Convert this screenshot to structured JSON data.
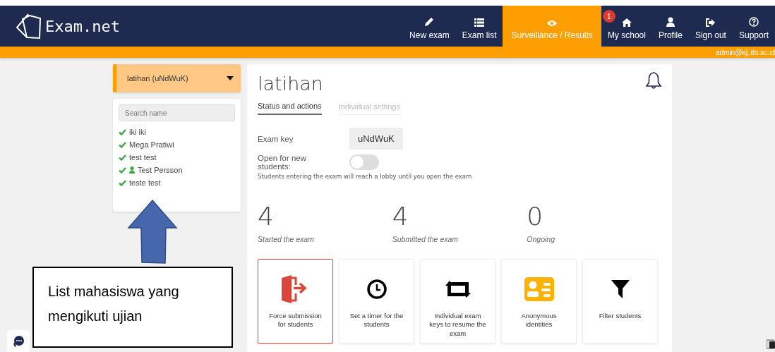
{
  "logo": {
    "text": "Exam.net"
  },
  "nav": [
    {
      "label": "New exam",
      "kind": "pencil",
      "selected": false
    },
    {
      "label": "Exam list",
      "kind": "list",
      "selected": false
    },
    {
      "label": "Surveillance / Results",
      "kind": "eye",
      "selected": true
    },
    {
      "label": "My school",
      "kind": "home",
      "selected": false,
      "badge": "1"
    },
    {
      "label": "Profile",
      "kind": "person",
      "selected": false
    },
    {
      "label": "Sign out",
      "kind": "signout",
      "selected": false
    },
    {
      "label": "Support",
      "kind": "help",
      "selected": false
    }
  ],
  "user_email": "admin@kjj.itb.ac.id",
  "exam_selector": {
    "value": "latihan (uNdWuK)"
  },
  "student_search": {
    "placeholder": "Search name"
  },
  "students": [
    {
      "name": "iki iki",
      "submitted": true,
      "user_icon": false
    },
    {
      "name": "Mega Pratiwi",
      "submitted": true,
      "user_icon": false
    },
    {
      "name": "test test",
      "submitted": true,
      "user_icon": false
    },
    {
      "name": "Test Persson",
      "submitted": true,
      "user_icon": true
    },
    {
      "name": "teste test",
      "submitted": true,
      "user_icon": false
    }
  ],
  "exam": {
    "title": "latihan",
    "tabs": [
      {
        "label": "Status and actions",
        "selected": true
      },
      {
        "label": "Individual settings",
        "selected": false
      }
    ],
    "exam_key_label": "Exam key",
    "exam_key": "uNdWuK",
    "open_label": "Open for new students:",
    "open_for_new": {
      "on": false
    },
    "note": "Students entering the exam will reach a lobby until you open the exam",
    "stats": [
      {
        "value": "4",
        "label": "Started the exam"
      },
      {
        "value": "4",
        "label": "Submitted the exam"
      },
      {
        "value": "0",
        "label": "Ongoing"
      }
    ],
    "actions": [
      {
        "label": "Force submission for students",
        "kind": "exit",
        "selected": true
      },
      {
        "label": "Set a timer for the students",
        "kind": "clock",
        "selected": false
      },
      {
        "label": "Individual exam keys to resume the exam",
        "kind": "retweet",
        "selected": false
      },
      {
        "label": "Anonymous identities",
        "kind": "idcard",
        "selected": false
      },
      {
        "label": "Filter students",
        "kind": "filter",
        "selected": false
      }
    ]
  },
  "annotation": {
    "text": "List mahasiswa yang mengikuti ujian"
  }
}
